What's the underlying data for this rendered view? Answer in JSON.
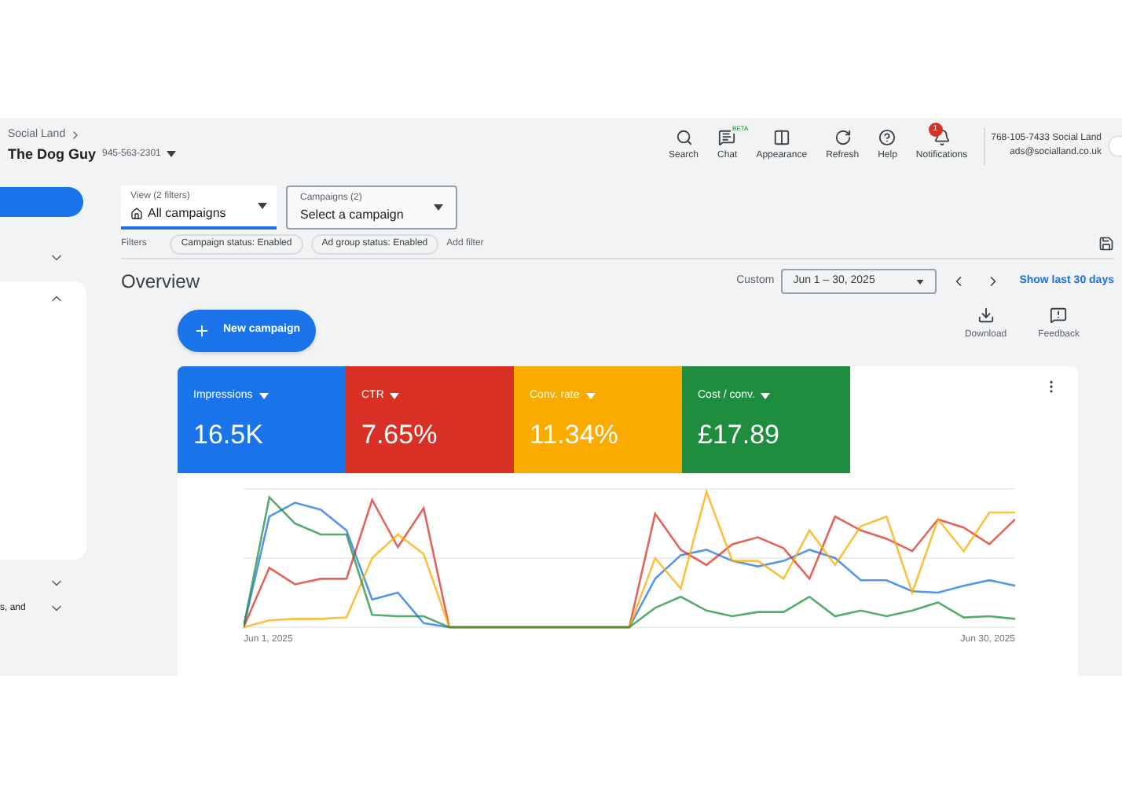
{
  "header": {
    "breadcrumb": "Social Land",
    "account_name": "The Dog Guy",
    "account_id": "945-563-2301"
  },
  "toolbar": [
    {
      "label": "Search",
      "kind": "search"
    },
    {
      "label": "Chat",
      "kind": "chat",
      "badge": "BETA"
    },
    {
      "label": "Appearance",
      "kind": "appearance"
    },
    {
      "label": "Refresh",
      "kind": "refresh"
    },
    {
      "label": "Help",
      "kind": "help"
    },
    {
      "label": "Notifications",
      "kind": "notifications",
      "count": "1"
    }
  ],
  "user": {
    "line_1": "768-105-7433 Social Land",
    "line_2": "ads@socialland.co.uk"
  },
  "sidebar": {
    "cut_label": "s, and"
  },
  "view_select": {
    "label": "View (2 filters)",
    "value": "All campaigns"
  },
  "campaign_select": {
    "label": "Campaigns (2)",
    "value": "Select a campaign"
  },
  "filters": {
    "label": "Filters",
    "chips": [
      "Campaign status: Enabled",
      "Ad group status: Enabled"
    ],
    "add": "Add filter"
  },
  "page_title": "Overview",
  "date": {
    "label": "Custom",
    "range": "Jun 1 – 30, 2025",
    "link": "Show last 30 days"
  },
  "new_campaign": "New campaign",
  "actions": [
    {
      "label": "Download",
      "kind": "download"
    },
    {
      "label": "Feedback",
      "kind": "feedback"
    }
  ],
  "metrics": [
    {
      "name": "Impressions",
      "value": "16.5K",
      "color": "#1a73e8"
    },
    {
      "name": "CTR",
      "value": "7.65%",
      "color": "#d93025"
    },
    {
      "name": "Conv. rate",
      "value": "11.34%",
      "color": "#f9ab00"
    },
    {
      "name": "Cost / conv.",
      "value": "£17.89",
      "color": "#1e8e3e"
    }
  ],
  "chart": {
    "x_start": "Jun 1, 2025",
    "x_end": "Jun 30, 2025"
  }
}
